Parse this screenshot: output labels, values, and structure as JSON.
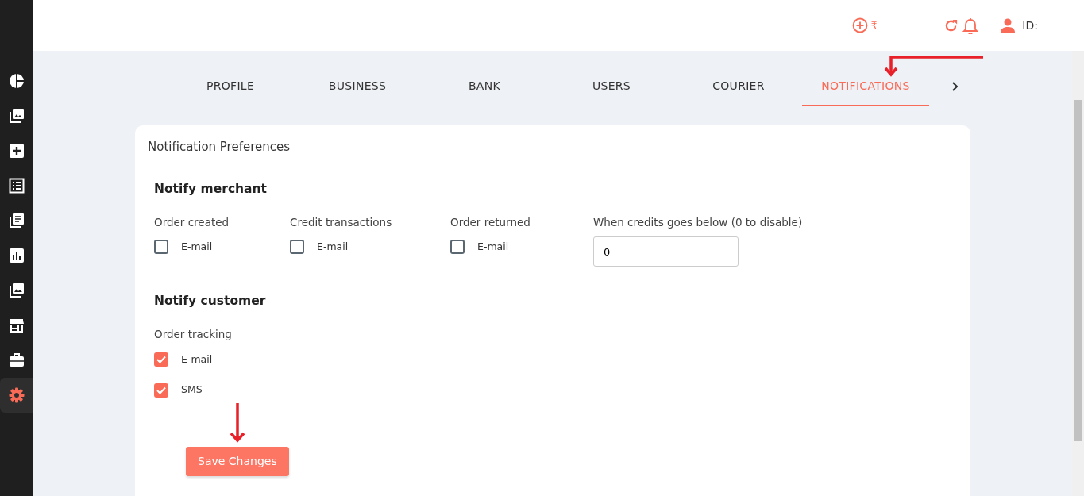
{
  "sidebar": {
    "items": [
      {
        "selected": false
      },
      {
        "selected": false
      },
      {
        "selected": false
      },
      {
        "selected": false
      },
      {
        "selected": false
      },
      {
        "selected": false
      },
      {
        "selected": false
      },
      {
        "selected": false
      },
      {
        "selected": false
      },
      {
        "selected": true
      }
    ]
  },
  "header": {
    "currency": "₹",
    "user_id_label": "ID:"
  },
  "tabs": [
    {
      "label": "PROFILE",
      "selected": false
    },
    {
      "label": "BUSINESS",
      "selected": false
    },
    {
      "label": "BANK",
      "selected": false
    },
    {
      "label": "USERS",
      "selected": false
    },
    {
      "label": "COURIER",
      "selected": false
    },
    {
      "label": "NOTIFICATIONS",
      "selected": true
    }
  ],
  "card": {
    "title": "Notification Preferences",
    "merchant": {
      "heading": "Notify merchant",
      "groups": [
        {
          "label": "Order created",
          "options": [
            {
              "label": "E-mail",
              "checked": false
            }
          ]
        },
        {
          "label": "Credit transactions",
          "options": [
            {
              "label": "E-mail",
              "checked": false
            }
          ]
        },
        {
          "label": "Order returned",
          "options": [
            {
              "label": "E-mail",
              "checked": false
            }
          ]
        }
      ],
      "threshold": {
        "label": "When credits goes below (0 to disable)",
        "value": "0"
      }
    },
    "customer": {
      "heading": "Notify customer",
      "groups": [
        {
          "label": "Order tracking",
          "options": [
            {
              "label": "E-mail",
              "checked": true
            },
            {
              "label": "SMS",
              "checked": true
            }
          ]
        }
      ]
    },
    "save_button": "Save Changes"
  }
}
